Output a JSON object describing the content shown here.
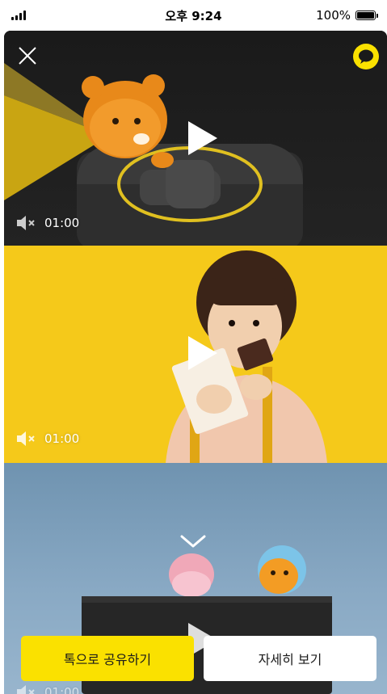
{
  "status_bar": {
    "time": "오후 9:24",
    "battery": "100%",
    "battery_level": 1.0
  },
  "header": {
    "close_icon": "close-icon",
    "talk_icon": "kakaotalk-icon",
    "accent_color": "#FAE100"
  },
  "videos": [
    {
      "duration": "01:00",
      "muted": true
    },
    {
      "duration": "01:00",
      "muted": true
    },
    {
      "duration": "01:00",
      "muted": true
    }
  ],
  "actions": {
    "share_label": "톡으로 공유하기",
    "detail_label": "자세히 보기"
  },
  "colors": {
    "share_button": "#FAE100",
    "detail_button": "#FFFFFF"
  }
}
